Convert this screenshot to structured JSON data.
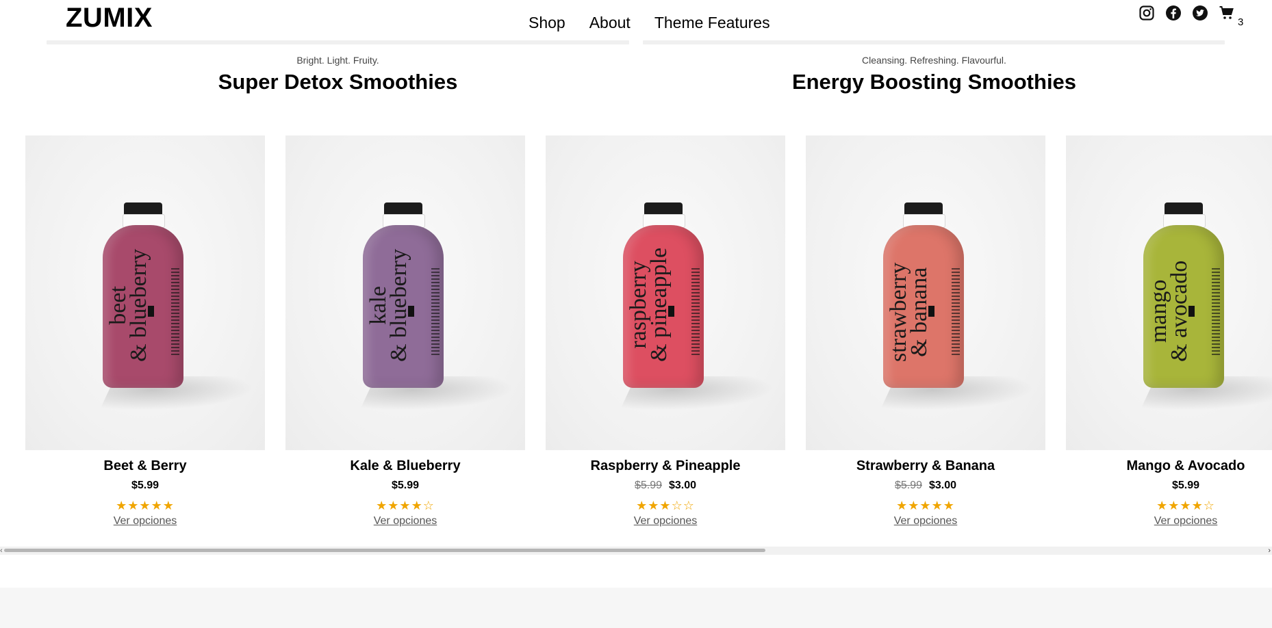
{
  "brand": {
    "logo": "ZUMIX"
  },
  "nav": {
    "items": [
      "Shop",
      "About",
      "Theme Features"
    ]
  },
  "header_icons": [
    "instagram-icon",
    "facebook-icon",
    "twitter-icon",
    "cart-icon"
  ],
  "cart": {
    "count": "3"
  },
  "sections": [
    {
      "subtitle": "Bright. Light. Fruity.",
      "title": "Super Detox Smoothies"
    },
    {
      "subtitle": "Cleansing. Refreshing. Flavourful.",
      "title": "Energy Boosting Smoothies"
    }
  ],
  "products": [
    {
      "name": "Beet & Berry",
      "price": "$5.99",
      "old_price": "",
      "rating": 5,
      "stars": "★★★★★",
      "link": "Ver opciones",
      "bottle_text": [
        "beet",
        "& blueberry"
      ],
      "color": "#a84a6b"
    },
    {
      "name": "Kale & Blueberry",
      "price": "$5.99",
      "old_price": "",
      "rating": 4,
      "stars": "★★★★☆",
      "link": "Ver opciones",
      "bottle_text": [
        "kale",
        "& blueberry"
      ],
      "color": "#8f6c98"
    },
    {
      "name": "Raspberry & Pineapple",
      "price": "$3.00",
      "old_price": "$5.99",
      "rating": 3,
      "stars": "★★★☆☆",
      "link": "Ver opciones",
      "bottle_text": [
        "raspberry",
        "& pineapple"
      ],
      "color": "#dd4f61"
    },
    {
      "name": "Strawberry & Banana",
      "price": "$3.00",
      "old_price": "$5.99",
      "rating": 5,
      "stars": "★★★★★",
      "link": "Ver opciones",
      "bottle_text": [
        "strawberry",
        "& banana"
      ],
      "color": "#dd7569"
    },
    {
      "name": "Mango & Avocado",
      "price": "$5.99",
      "old_price": "",
      "rating": 4,
      "stars": "★★★★☆",
      "link": "Ver opciones",
      "bottle_text": [
        "mango",
        "& avocado"
      ],
      "color": "#a8b53a"
    }
  ],
  "colors": {
    "star": "#f0a500",
    "background": "#ffffff",
    "footer": "#f6f6f6"
  },
  "scroll": {
    "position_fraction": 0.0
  }
}
